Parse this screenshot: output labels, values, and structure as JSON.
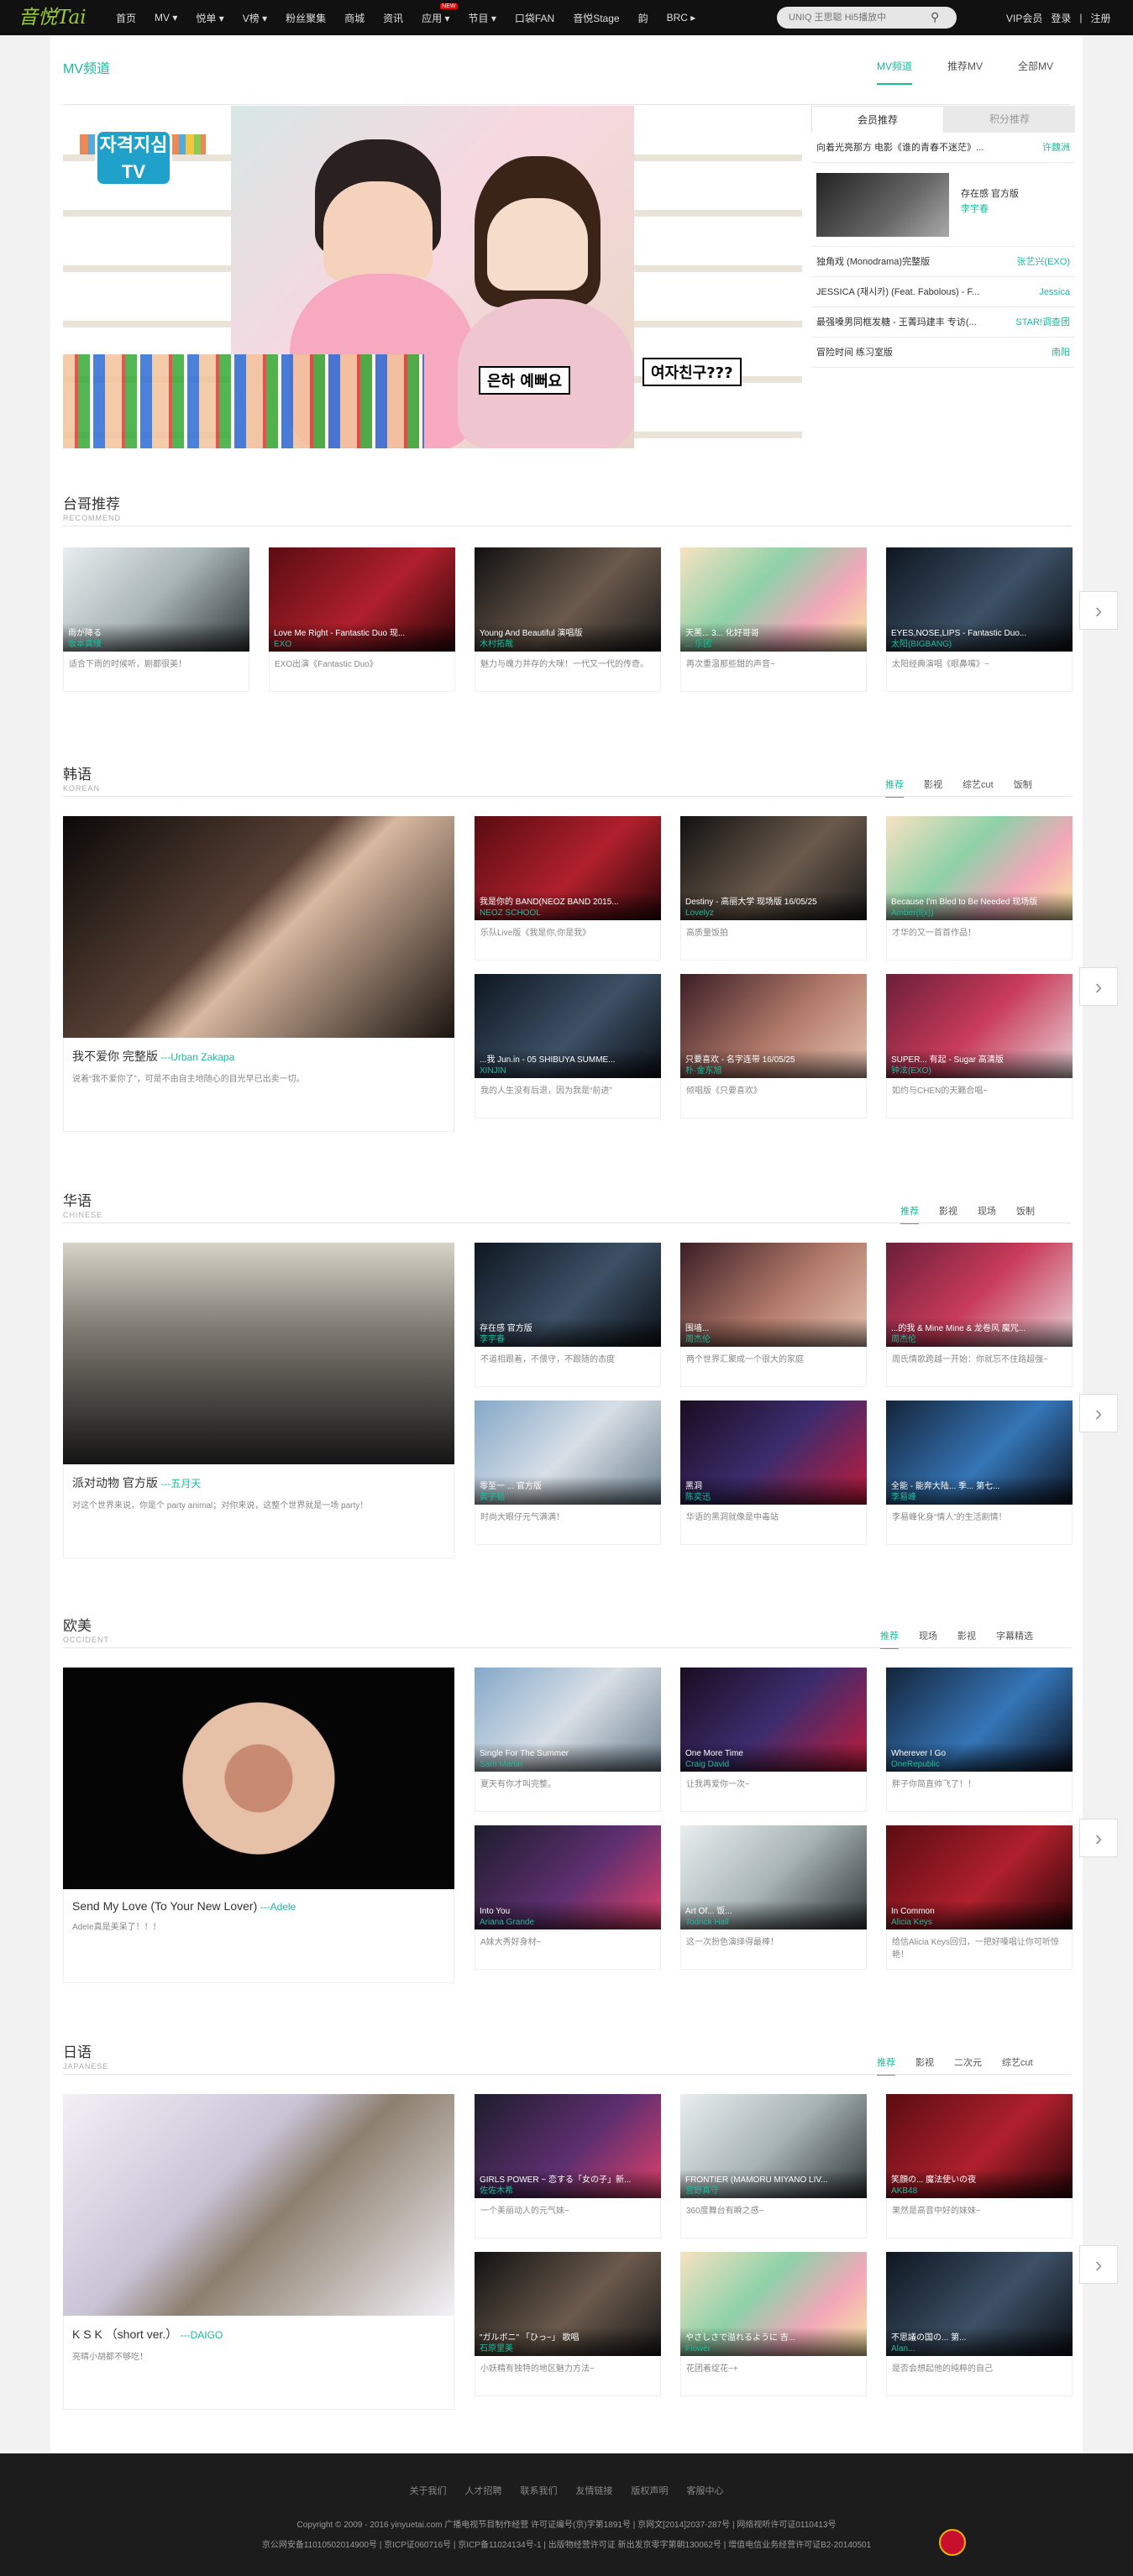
{
  "topbar": {
    "logo": "音悦Tai",
    "nav": [
      "首页",
      "MV ▾",
      "悦单 ▾",
      "V榜 ▾",
      "粉丝聚集",
      "商城",
      "资讯",
      "应用 ▾",
      "节目 ▾",
      "口袋FAN",
      "音悦Stage",
      "韵",
      "BRC ▸"
    ],
    "new_badge": "NEW",
    "search_placeholder": "UNIQ 王思聪 Hi5播放中",
    "right": [
      "VIP会员",
      "登录",
      "|",
      "注册"
    ]
  },
  "mv": {
    "title": "MV频道",
    "tabs": [
      "MV频道",
      "推荐MV",
      "全部MV"
    ],
    "hero": {
      "tv_logo": "자격지심\nTV",
      "bubble1": "은하 예뻐요",
      "bubble2": "여자친구???"
    },
    "side": {
      "tabs": [
        "会员推荐",
        "积分推荐"
      ],
      "top_row": {
        "title": "向着光亮那方 电影《谁的青春不迷茫》...",
        "artist": "许魏洲"
      },
      "featured": {
        "title": "存在感 官方版",
        "artist": "李宇春"
      },
      "rows": [
        {
          "title": "独角戏 (Monodrama)完整版",
          "artist": "张艺兴(EXO)"
        },
        {
          "title": "JESSICA (재시카) (Feat. Fabolous) - F...",
          "artist": "Jessica"
        },
        {
          "title": "最强嗓男同框发糖 - 王菁玛建丰 专访(...",
          "artist": "STAR!调查团"
        },
        {
          "title": "冒险时间 练习室版",
          "artist": "南阳"
        }
      ]
    }
  },
  "sections": {
    "recommend": {
      "title": "台哥推荐",
      "sub": "RECOMMEND",
      "cards": [
        {
          "title": "雨が降る",
          "artist": "坂本真绫",
          "desc": "适合下雨的时候听，剧都很美！"
        },
        {
          "title": "Love Me Right - Fantastic Duo 现...",
          "artist": "EXO",
          "desc": "EXO出演《Fantastic Duo》"
        },
        {
          "title": "Young And Beautiful 演唱版",
          "artist": "木村拓哉",
          "desc": "魅力与魄力并存的大咪！一代又一代的传奇。"
        },
        {
          "title": "天黑... 3... 化好哥哥",
          "artist": "... 乐团",
          "desc": "再次重温那些甜的声音~"
        },
        {
          "title": "EYES,NOSE,LIPS - Fantastic Duo...",
          "artist": "太阳(BIGBANG)",
          "desc": "太阳经典演唱《眼鼻嘴》~"
        }
      ]
    },
    "korean": {
      "title": "韩语",
      "sub": "KOREAN",
      "tabs": [
        "推荐",
        "影视",
        "综艺cut",
        "饭制"
      ],
      "big": {
        "title": "我不爱你 完整版",
        "artist": "---Urban Zakapa",
        "desc": "说着“我不爱你了”，可是不由自主地随心的目光早已出卖一切。"
      },
      "cards": [
        {
          "title": "我是你的 BAND(NEOZ BAND 2015...",
          "artist": "NEOZ SCHOOL",
          "desc": "乐队Live版《我是你,你是我》"
        },
        {
          "title": "Destiny - 高丽大学 现场版 16/05/25",
          "artist": "Lovelyz",
          "desc": "高质量饭拍"
        },
        {
          "title": "Because I'm Bled to Be Needed 现场版",
          "artist": "Amber(f(x))",
          "desc": "才华的又一首首作品！"
        },
        {
          "title": "...我 Jun.in - 05 SHIBUYA SUMME...",
          "artist": "XINJIN",
          "desc": "我的人生没有后退，因为我是“前进”"
        },
        {
          "title": "只要喜欢 - 名字连带 16/05/25",
          "artist": "朴·金东旭",
          "desc": "倾唱版《只要喜欢》"
        },
        {
          "title": "SUPER... 有起 - Sugar 高清版",
          "artist": "钟泫(EXO)",
          "desc": "如约与CHEN的天籁合唱~"
        }
      ]
    },
    "chinese": {
      "title": "华语",
      "sub": "CHINESE",
      "tabs": [
        "推荐",
        "影视",
        "现场",
        "饭制"
      ],
      "big": {
        "title": "派对动物 官方版",
        "artist": "---五月天",
        "desc": "对这个世界来说，你是个 party animal；对你来说，这整个世界就是一场 party！"
      },
      "cards": [
        {
          "title": "存在感 官方版",
          "artist": "李宇春",
          "desc": "不道相跟着，不偎守，不跟随的态度"
        },
        {
          "title": "围墙...",
          "artist": "周杰伦",
          "desc": "两个世界汇聚成一个很大的家庭"
        },
        {
          "title": "...的我 & Mine Mine & 龙卷风 魔咒...",
          "artist": "周杰伦",
          "desc": "周氏情歌跨越一开始：你就忘不住路超强~"
        },
        {
          "title": "零至一 ... 官方版",
          "artist": "黄子韬",
          "desc": "时尚大眼仔元气满满！"
        },
        {
          "title": "黑洞",
          "artist": "陈奕迅",
          "desc": "华语的黑洞就像是中毒站"
        },
        {
          "title": "全能 - 能奔大陆... 季... 第七...",
          "artist": "李易峰",
          "desc": "李易峰化身“情人”的生活剧情！"
        }
      ]
    },
    "occident": {
      "title": "欧美",
      "sub": "OCCIDENT",
      "tabs": [
        "推荐",
        "现场",
        "影视",
        "字幕精选"
      ],
      "big": {
        "title": "Send My Love (To Your New Lover)",
        "artist": "---Adele",
        "desc": "Adele真是美呆了！！！"
      },
      "cards": [
        {
          "title": "Single For The Summer",
          "artist": "Sam Martin",
          "desc": "夏天有你才叫完整。"
        },
        {
          "title": "One More Time",
          "artist": "Craig David",
          "desc": "让我再爱你一次~"
        },
        {
          "title": "Wherever I Go",
          "artist": "OneRepublic",
          "desc": "胖子你简直帅飞了！！"
        },
        {
          "title": "Into You",
          "artist": "Ariana Grande",
          "desc": "A妹大秀好身材~"
        },
        {
          "title": "Art Of... 饭...",
          "artist": "Todrick Hall",
          "desc": "这一次扮色演绎得最棒！"
        },
        {
          "title": "In Common",
          "artist": "Alicia Keys",
          "desc": "给信Alicia Keys回归，一把好嗓唱让你可听惊艳！"
        }
      ]
    },
    "japanese": {
      "title": "日语",
      "sub": "JAPANESE",
      "tabs": [
        "推荐",
        "影视",
        "二次元",
        "综艺cut"
      ],
      "big": {
        "title": "K S K （short ver.）",
        "artist": "---DAIGO",
        "desc": "亮晴小胡都不够吃！"
      },
      "cards": [
        {
          "title": "GIRLS POWER ~ 恋する「女の子」新...",
          "artist": "佐佐木希",
          "desc": "一个美丽动人的元气妹~"
        },
        {
          "title": "FRONTIER (MAMORU MIYANO LIV...",
          "artist": "宫野真守",
          "desc": "360度舞台有瞬之感~"
        },
        {
          "title": "笑顔の... 魔法使いの夜",
          "artist": "AKB48",
          "desc": "果然是高音中好的妹妹~"
        },
        {
          "title": "\"ガルボニ\" 「ひっ~」 歌唱",
          "artist": "石原里美",
          "desc": "小妖精有独特的地区魅力方法~"
        },
        {
          "title": "やさしさで溢れるように 吉...",
          "artist": "Flower",
          "desc": "花团着绽花~+"
        },
        {
          "title": "不思議の国の... 第...",
          "artist": "Alan...",
          "desc": "是否会想起他的纯粹的自己"
        }
      ]
    }
  },
  "footer": {
    "links": [
      "关于我们",
      "人才招聘",
      "联系我们",
      "友情链接",
      "版权声明",
      "客服中心"
    ],
    "copyright": "Copyright © 2009 - 2016 yinyuetai.com 广播电视节目制作经营 许可证编号(京)字第1891号 | 京网文[2014]2037-287号 | 网络视听许可证0110413号",
    "license": "京公网安备11010502014900号 | 京ICP证060716号 | 京ICP备11024134号-1 | 出版物经营许可证 新出发京零字第朝130062号 | 增值电信业务经营许可证B2-20140501"
  },
  "colors": {
    "accent": "#1abc9c",
    "topbar": "#111111",
    "footer": "#1c1c1c"
  }
}
